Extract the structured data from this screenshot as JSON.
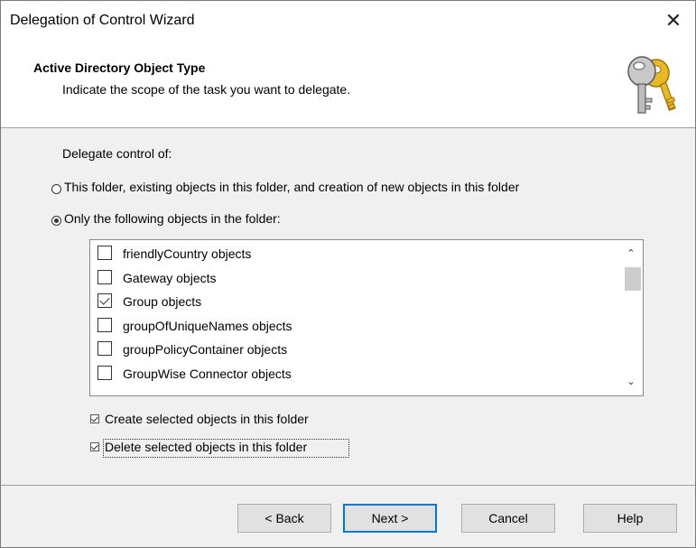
{
  "window": {
    "title": "Delegation of Control Wizard",
    "close_glyph": "✕"
  },
  "header": {
    "title": "Active Directory Object Type",
    "subtitle": "Indicate the scope of the task you want to delegate.",
    "icon": "keys-icon"
  },
  "content": {
    "delegate_label": "Delegate control of:",
    "radio_this_folder": {
      "label": "This folder, existing objects in this folder, and creation of new objects in this folder",
      "selected": false
    },
    "radio_only_following": {
      "label": "Only the following objects in the folder:",
      "selected": true
    },
    "objects": [
      {
        "label": "friendlyCountry objects",
        "checked": false
      },
      {
        "label": "Gateway objects",
        "checked": false
      },
      {
        "label": "Group objects",
        "checked": true
      },
      {
        "label": "groupOfUniqueNames objects",
        "checked": false
      },
      {
        "label": "groupPolicyContainer objects",
        "checked": false
      },
      {
        "label": "GroupWise Connector objects",
        "checked": false
      }
    ],
    "scroll_up_glyph": "⌃",
    "scroll_down_glyph": "⌄",
    "create_checkbox": {
      "label": "Create selected objects in this folder",
      "checked": true
    },
    "delete_checkbox": {
      "label": "Delete selected objects in this folder",
      "checked": true
    }
  },
  "buttons": {
    "back": "< Back",
    "next": "Next >",
    "cancel": "Cancel",
    "help": "Help"
  }
}
